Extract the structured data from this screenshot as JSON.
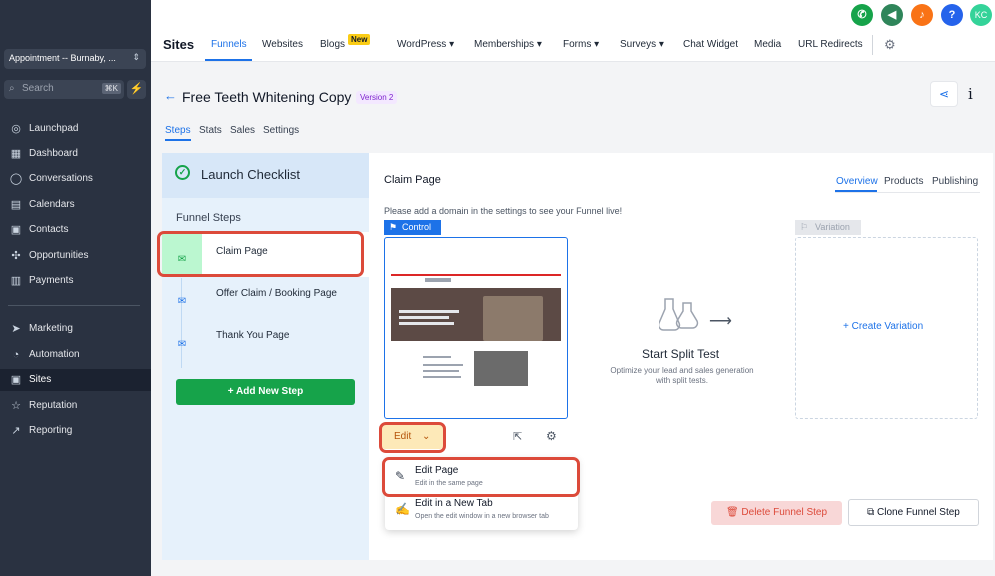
{
  "sidebar": {
    "account": "Appointment -- Burnaby, ...",
    "search_placeholder": "Search",
    "search_shortcut": "⌘K",
    "items": [
      {
        "label": "Launchpad"
      },
      {
        "label": "Dashboard"
      },
      {
        "label": "Conversations"
      },
      {
        "label": "Calendars"
      },
      {
        "label": "Contacts"
      },
      {
        "label": "Opportunities"
      },
      {
        "label": "Payments"
      },
      {
        "label": "Marketing"
      },
      {
        "label": "Automation"
      },
      {
        "label": "Sites"
      },
      {
        "label": "Reputation"
      },
      {
        "label": "Reporting"
      }
    ]
  },
  "topbar": {
    "title": "Sites",
    "nav": [
      "Funnels",
      "Websites",
      "Blogs",
      "WordPress",
      "Memberships",
      "Forms",
      "Surveys",
      "Chat Widget",
      "Media",
      "URL Redirects"
    ],
    "new_badge": "New",
    "user_initials": "KC"
  },
  "funnel": {
    "title": "Free Teeth Whitening Copy",
    "version": "Version 2",
    "tabs": [
      "Steps",
      "Stats",
      "Sales",
      "Settings"
    ]
  },
  "left_panel": {
    "launch_checklist": "Launch Checklist",
    "funnel_steps": "Funnel Steps",
    "steps": [
      "Claim Page",
      "Offer Claim / Booking Page",
      "Thank You Page"
    ],
    "add_step": "Add New Step"
  },
  "main": {
    "step_title": "Claim Page",
    "tabs": [
      "Overview",
      "Products",
      "Publishing"
    ],
    "domain_msg": "Please add a domain in the settings to see your Funnel live!",
    "control_label": "Control",
    "variation_label": "Variation",
    "edit_label": "Edit",
    "split_title": "Start Split Test",
    "split_sub": "Optimize your lead and sales generation with split tests.",
    "create_variation": "Create Variation",
    "delete_step": "Delete Funnel Step",
    "clone_step": "Clone Funnel Step"
  },
  "dropdown": {
    "edit_page": "Edit Page",
    "edit_page_sub": "Edit in the same page",
    "edit_new_tab": "Edit in a New Tab",
    "edit_new_tab_sub": "Open the edit window in a new browser tab"
  },
  "colors": {
    "accent": "#1d72e8",
    "sidebar": "#2a3241",
    "success": "#16a34a",
    "highlight": "#dc4a3a"
  }
}
